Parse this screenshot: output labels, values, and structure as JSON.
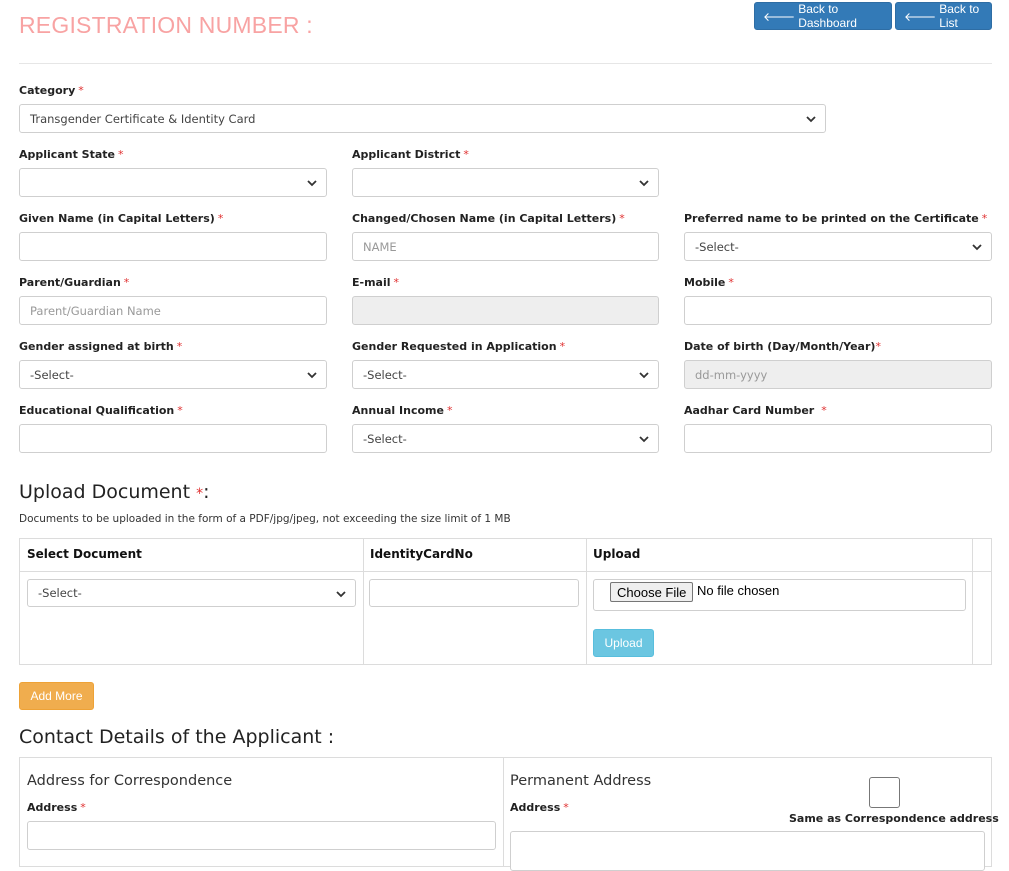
{
  "header": {
    "title": "REGISTRATION NUMBER :",
    "back_dashboard": "Back to Dashboard",
    "back_list": "Back to List"
  },
  "colors": {
    "title": "#f8a3a3",
    "primary": "#337ab7",
    "info": "#5bc0de",
    "warning": "#f0ad4e",
    "required": "#e03030"
  },
  "required_mark": "*",
  "form": {
    "category": {
      "label": "Category",
      "value": "Transgender Certificate & Identity Card"
    },
    "state": {
      "label": "Applicant State",
      "value": ""
    },
    "district": {
      "label": "Applicant District",
      "value": ""
    },
    "given_name": {
      "label": "Given Name (in Capital Letters)",
      "value": ""
    },
    "chosen_name": {
      "label": "Changed/Chosen Name (in Capital Letters)",
      "placeholder": "NAME"
    },
    "preferred_name": {
      "label": "Preferred name to be printed on the Certificate",
      "value": "-Select-"
    },
    "parent": {
      "label": "Parent/Guardian",
      "placeholder": "Parent/Guardian Name"
    },
    "email": {
      "label": "E-mail",
      "value": ""
    },
    "mobile": {
      "label": "Mobile",
      "value": ""
    },
    "gender_birth": {
      "label": "Gender assigned at birth",
      "value": "-Select-"
    },
    "gender_requested": {
      "label": "Gender Requested in Application",
      "value": "-Select-"
    },
    "dob": {
      "label": "Date of birth (Day/Month/Year)",
      "placeholder": "dd-mm-yyyy"
    },
    "education": {
      "label": "Educational Qualification",
      "value": ""
    },
    "income": {
      "label": "Annual Income",
      "value": "-Select-"
    },
    "aadhar": {
      "label": "Aadhar Card Number",
      "value": ""
    }
  },
  "upload": {
    "heading": "Upload Document",
    "colon": ":",
    "note": "Documents to be uploaded in the form of a PDF/jpg/jpeg, not exceeding the size limit of 1 MB",
    "columns": [
      "Select Document",
      "IdentityCardNo",
      "Upload"
    ],
    "row": {
      "document": "-Select-",
      "identity_no": "",
      "choose_file": "Choose File",
      "file_status": "No file chosen",
      "upload_button": "Upload"
    },
    "add_more": "Add More"
  },
  "contact": {
    "heading": "Contact Details of the Applicant :",
    "correspondence": {
      "title": "Address for Correspondence",
      "address_label": "Address",
      "value": ""
    },
    "permanent": {
      "title": "Permanent Address",
      "address_label": "Address",
      "value": ""
    },
    "same_as_label": "Same as Correspondence address",
    "same_as_checked": false
  }
}
